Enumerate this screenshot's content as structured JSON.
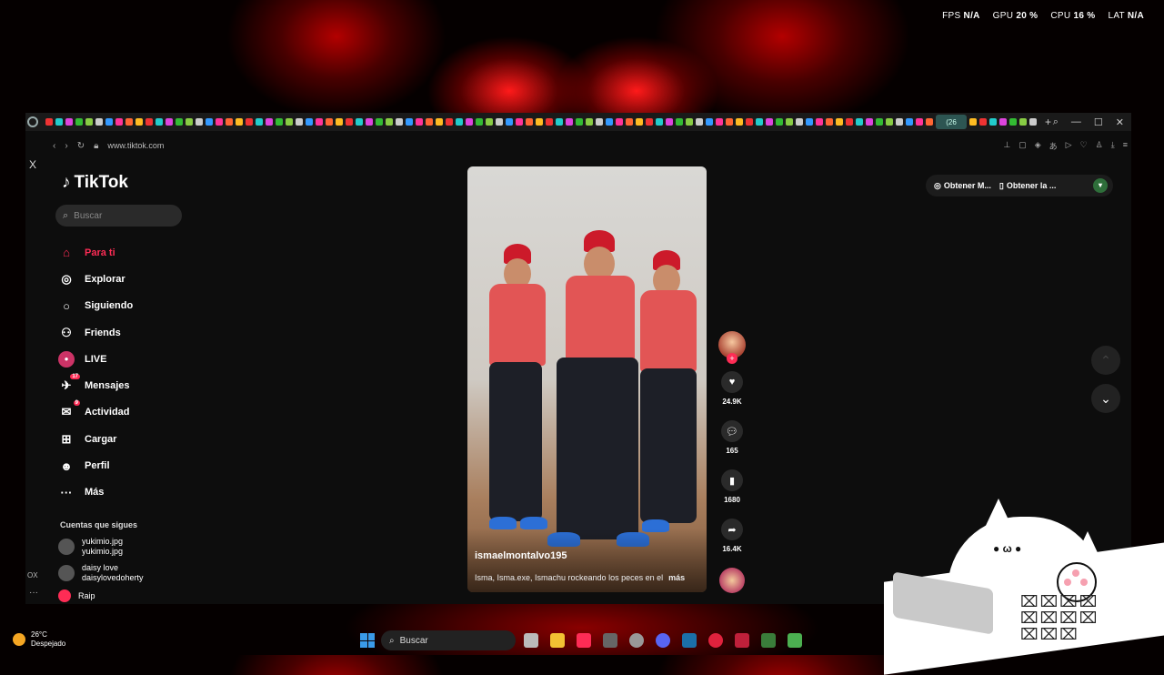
{
  "overlay": {
    "fps_label": "FPS",
    "fps": "N/A",
    "gpu_label": "GPU",
    "gpu": "20 %",
    "cpu_label": "CPU",
    "cpu": "16 %",
    "lat_label": "LAT",
    "lat": "N/A"
  },
  "browser": {
    "url": "www.tiktok.com",
    "active_tab": "(26",
    "side_x": "X",
    "side_ox": "OX",
    "side_more": "···"
  },
  "tiktok": {
    "logo": "TikTok",
    "search_placeholder": "Buscar",
    "menu": [
      {
        "label": "Para ti",
        "icon": "home-icon",
        "glyph": "⌂"
      },
      {
        "label": "Explorar",
        "icon": "compass-icon",
        "glyph": "◎"
      },
      {
        "label": "Siguiendo",
        "icon": "following-avatar",
        "glyph": "○"
      },
      {
        "label": "Friends",
        "icon": "friends-icon",
        "glyph": "⚇"
      },
      {
        "label": "LIVE",
        "icon": "live-icon",
        "glyph": "●"
      },
      {
        "label": "Mensajes",
        "icon": "inbox-icon",
        "glyph": "✈",
        "badge": "17"
      },
      {
        "label": "Actividad",
        "icon": "activity-icon",
        "glyph": "✉",
        "badge": "9"
      },
      {
        "label": "Cargar",
        "icon": "upload-icon",
        "glyph": "⊞"
      },
      {
        "label": "Perfil",
        "icon": "profile-icon",
        "glyph": "☻"
      },
      {
        "label": "Más",
        "icon": "more-icon",
        "glyph": "···"
      }
    ],
    "following_title": "Cuentas que sigues",
    "accounts": [
      {
        "name": "yukimio.jpg",
        "handle": "yukimio.jpg"
      },
      {
        "name": "daisy love",
        "handle": "daisylovedoherty"
      },
      {
        "name": "Raip",
        "handle": ""
      }
    ],
    "video": {
      "username": "ismaelmontalvo195",
      "description": "Isma, Isma.exe, Ismachu rockeando los peces en el",
      "more": "más"
    },
    "actions": {
      "likes": "24.9K",
      "comments": "165",
      "saves": "1680",
      "shares": "16.4K"
    },
    "get_app_1": "Obtener M...",
    "get_app_2": "Obtener la ..."
  },
  "taskbar": {
    "temp": "26°C",
    "weather": "Despejado",
    "search": "Buscar"
  },
  "colors": {
    "accent": "#fe2c55",
    "win_blue": "#3a9ae8"
  }
}
